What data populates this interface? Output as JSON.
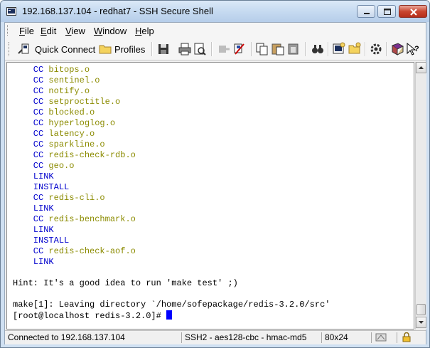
{
  "window": {
    "title": "192.168.137.104 - redhat7 - SSH Secure Shell",
    "buttons": [
      "minimize-icon",
      "maximize-icon",
      "close-icon"
    ]
  },
  "menubar": {
    "items": [
      {
        "label": "File",
        "accel": "F",
        "rest": "ile"
      },
      {
        "label": "Edit",
        "accel": "E",
        "rest": "dit"
      },
      {
        "label": "View",
        "accel": "V",
        "rest": "iew"
      },
      {
        "label": "Window",
        "accel": "W",
        "rest": "indow"
      },
      {
        "label": "Help",
        "accel": "H",
        "rest": "elp"
      }
    ]
  },
  "toolbar": {
    "quick_connect_label": "Quick Connect",
    "profiles_label": "Profiles",
    "icons": [
      "save-icon",
      "print-icon",
      "print-preview-icon",
      "disconnect-icon",
      "connect-icon",
      "copy-icon",
      "paste-icon",
      "paste-all-icon",
      "find-icon",
      "new-terminal-icon",
      "new-file-transfer-icon",
      "settings-icon",
      "help-book-icon",
      "context-help-icon"
    ]
  },
  "terminal": {
    "lines": [
      {
        "prefix": "    CC ",
        "text": "bitops.o",
        "kind": "cc"
      },
      {
        "prefix": "    CC ",
        "text": "sentinel.o",
        "kind": "cc"
      },
      {
        "prefix": "    CC ",
        "text": "notify.o",
        "kind": "cc"
      },
      {
        "prefix": "    CC ",
        "text": "setproctitle.o",
        "kind": "cc"
      },
      {
        "prefix": "    CC ",
        "text": "blocked.o",
        "kind": "cc"
      },
      {
        "prefix": "    CC ",
        "text": "hyperloglog.o",
        "kind": "cc"
      },
      {
        "prefix": "    CC ",
        "text": "latency.o",
        "kind": "cc"
      },
      {
        "prefix": "    CC ",
        "text": "sparkline.o",
        "kind": "cc"
      },
      {
        "prefix": "    CC ",
        "text": "redis-check-rdb.o",
        "kind": "cc"
      },
      {
        "prefix": "    CC ",
        "text": "geo.o",
        "kind": "cc"
      },
      {
        "prefix": "    ",
        "text": "LINK",
        "kind": "kw"
      },
      {
        "prefix": "    ",
        "text": "INSTALL",
        "kind": "kw"
      },
      {
        "prefix": "    CC ",
        "text": "redis-cli.o",
        "kind": "cc"
      },
      {
        "prefix": "    ",
        "text": "LINK",
        "kind": "kw"
      },
      {
        "prefix": "    CC ",
        "text": "redis-benchmark.o",
        "kind": "cc"
      },
      {
        "prefix": "    ",
        "text": "LINK",
        "kind": "kw"
      },
      {
        "prefix": "    ",
        "text": "INSTALL",
        "kind": "kw"
      },
      {
        "prefix": "    CC ",
        "text": "redis-check-aof.o",
        "kind": "cc"
      },
      {
        "prefix": "    ",
        "text": "LINK",
        "kind": "kw"
      },
      {
        "prefix": "",
        "text": "",
        "kind": "plain"
      },
      {
        "prefix": "",
        "text": "Hint: It's a good idea to run 'make test' ;)",
        "kind": "plain"
      },
      {
        "prefix": "",
        "text": "",
        "kind": "plain"
      },
      {
        "prefix": "",
        "text": "make[1]: Leaving directory `/home/sofepackage/redis-3.2.0/src'",
        "kind": "plain"
      },
      {
        "prefix": "",
        "text": "[root@localhost redis-3.2.0]# ",
        "kind": "prompt"
      }
    ]
  },
  "statusbar": {
    "connection": "Connected to 192.168.137.104",
    "cipher": "SSH2 - aes128-cbc - hmac-md5",
    "size": "80x24"
  },
  "colors": {
    "cc_prefix": "#0000cc",
    "object_file": "#8b8b00",
    "keyword": "#0000cc",
    "cursor": "#0000ff"
  }
}
